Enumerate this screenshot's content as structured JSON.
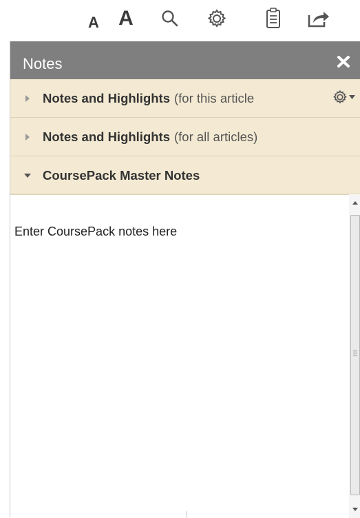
{
  "toolbar": {
    "font_small_label": "A",
    "font_large_label": "A",
    "icons": [
      "font-small-icon",
      "font-large-icon",
      "search-icon",
      "gear-icon",
      "notes-icon",
      "share-icon"
    ]
  },
  "panel": {
    "title": "Notes",
    "close_label": "x"
  },
  "sections": [
    {
      "title": "Notes and Highlights",
      "subtitle": "(for this article",
      "expanded": false
    },
    {
      "title": "Notes and Highlights",
      "subtitle": "(for all articles)",
      "expanded": false
    },
    {
      "title": "CoursePack Master Notes",
      "subtitle": "",
      "expanded": true
    }
  ],
  "notes": {
    "placeholder": "Enter CoursePack notes here"
  },
  "colors": {
    "header_bg": "#7f7f7f",
    "section_bg": "#f4ead3",
    "icon_color": "#4a4a4a"
  }
}
